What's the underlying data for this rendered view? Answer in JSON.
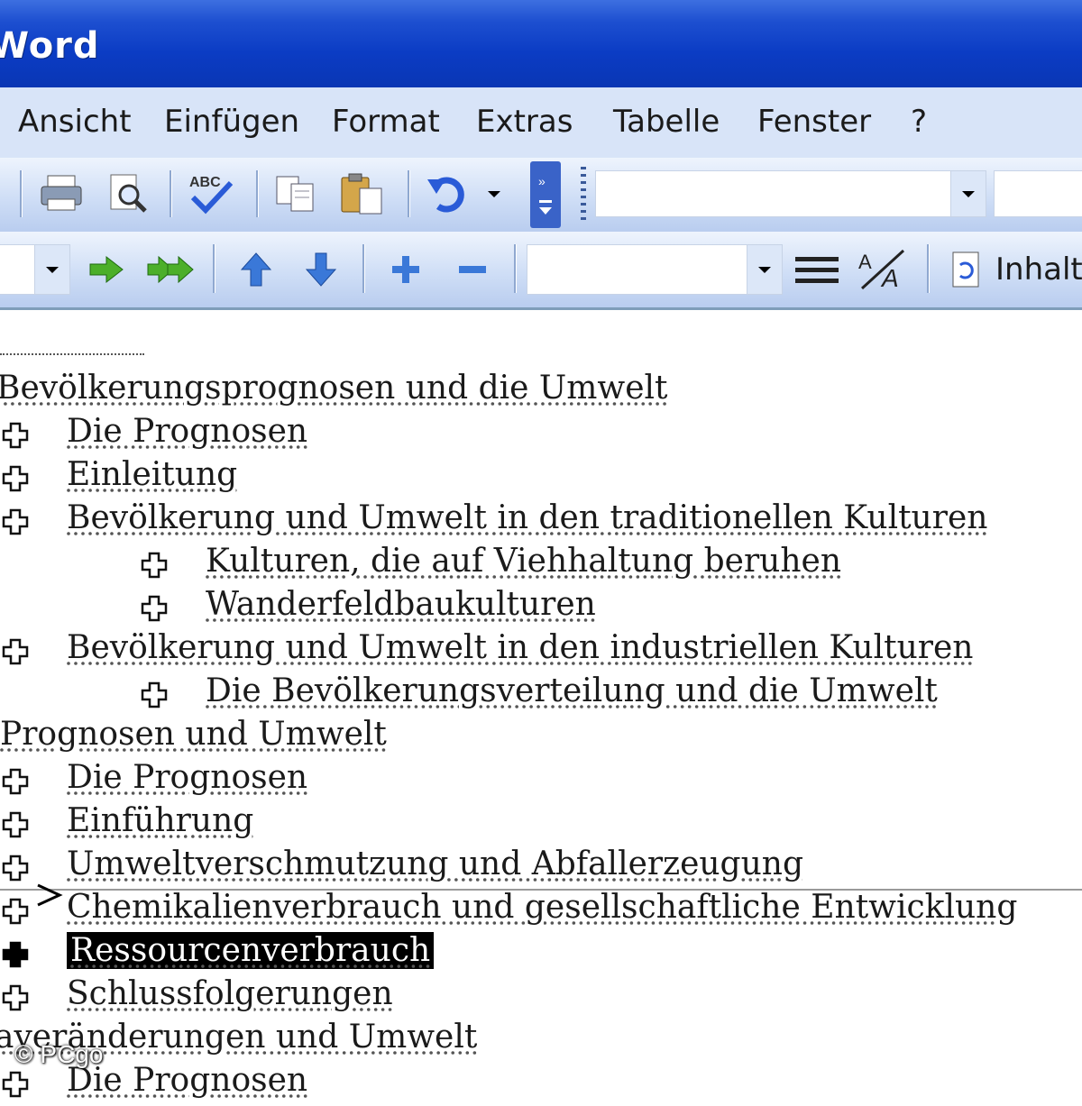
{
  "window": {
    "title": "Word"
  },
  "menu": [
    {
      "label": "Ansicht"
    },
    {
      "label": "Einfügen"
    },
    {
      "label": "Format"
    },
    {
      "label": "Extras"
    },
    {
      "label": "Tabelle"
    },
    {
      "label": "Fenster"
    },
    {
      "label": "?"
    }
  ],
  "toolbar1": {
    "icons": [
      "print-icon",
      "print-preview-icon",
      "spelling-icon",
      "copy-icon",
      "paste-icon",
      "undo-icon"
    ],
    "font_combo_value": ""
  },
  "toolbar2": {
    "style_combo_value": "",
    "level_combo_value": "",
    "update_toc_label": "Inhalts"
  },
  "document": {
    "headings": [
      {
        "text": "Bevölkerungsprognosen und die Umwelt"
      },
      {
        "text": "Prognosen und Umwelt"
      },
      {
        "text": "averänderungen und Umwelt"
      }
    ],
    "items": [
      {
        "text": "Die Prognosen"
      },
      {
        "text": "Einleitung"
      },
      {
        "text": "Bevölkerung und Umwelt in den traditionellen Kulturen"
      },
      {
        "text": "Kulturen, die auf Viehhaltung beruhen"
      },
      {
        "text": "Wanderfeldbaukulturen"
      },
      {
        "text": "Bevölkerung und Umwelt in den industriellen Kulturen"
      },
      {
        "text": "Die Bevölkerungsverteilung und die Umwelt"
      },
      {
        "text": "Die Prognosen"
      },
      {
        "text": "Einführung"
      },
      {
        "text": "Umweltverschmutzung und Abfallerzeugung"
      },
      {
        "text": "Chemikalienverbrauch und gesellschaftliche Entwicklung"
      },
      {
        "text": "Ressourcenverbrauch"
      },
      {
        "text": "Schlussfolgerungen"
      },
      {
        "text": "Die Prognosen"
      }
    ]
  },
  "watermark": "© PCgo",
  "colors": {
    "title_bar": "#0b3cc4",
    "menu_bg": "#d8e4f8",
    "selection": "#000000"
  }
}
